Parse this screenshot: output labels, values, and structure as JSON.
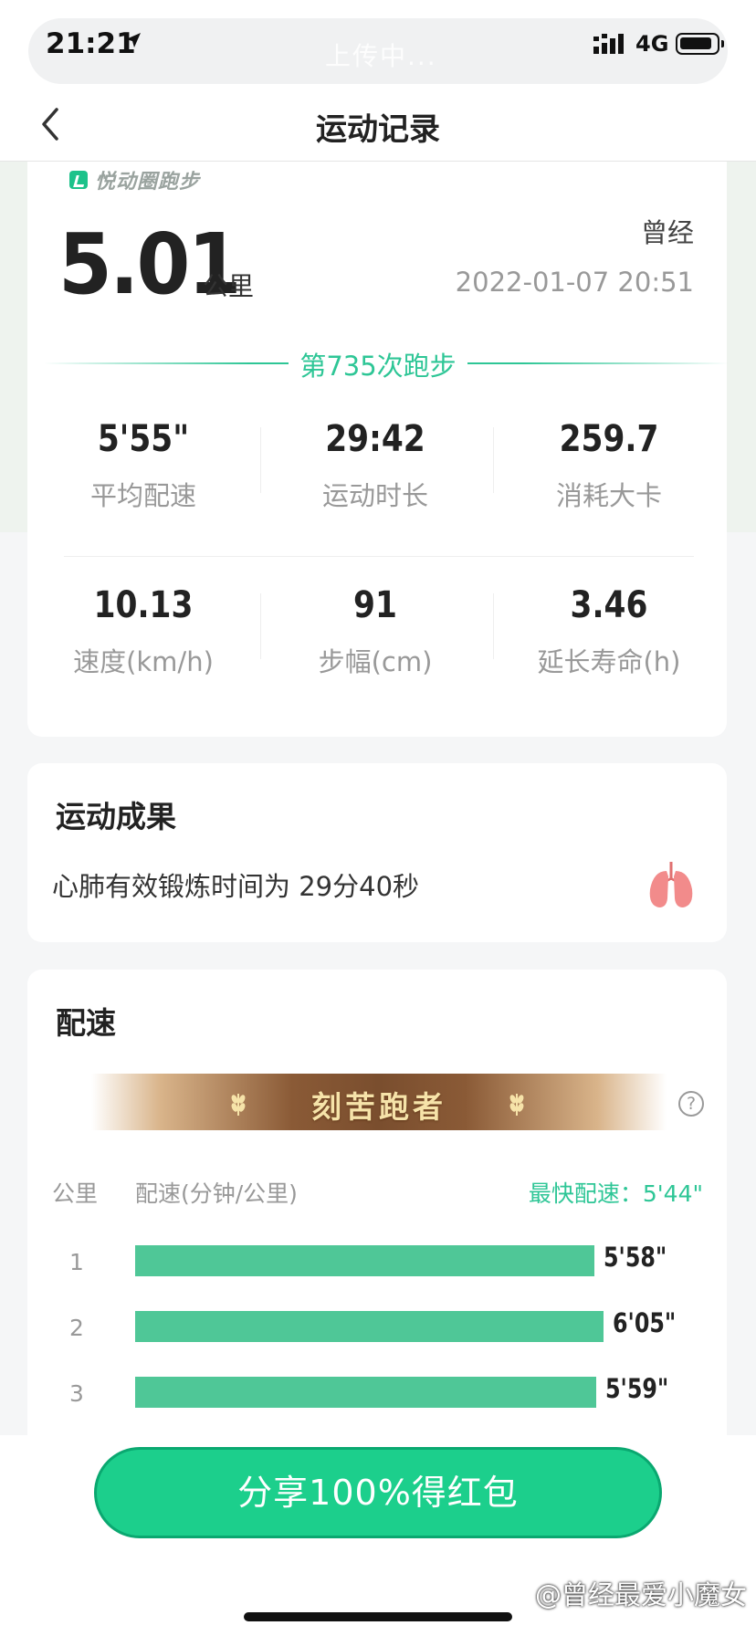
{
  "status_bar": {
    "time": "21:21",
    "upload_status": "上传中...",
    "network": "4G"
  },
  "nav": {
    "title": "运动记录"
  },
  "summary": {
    "brand": "悦动圈跑步",
    "distance": "5.01",
    "distance_unit": "公里",
    "username": "曾经",
    "datetime": "2022-01-07 20:51",
    "run_count": "第735次跑步",
    "stats": [
      {
        "value": "5'55\"",
        "label": "平均配速"
      },
      {
        "value": "29:42",
        "label": "运动时长"
      },
      {
        "value": "259.7",
        "label": "消耗大卡"
      },
      {
        "value": "10.13",
        "label": "速度(km/h)"
      },
      {
        "value": "91",
        "label": "步幅(cm)"
      },
      {
        "value": "3.46",
        "label": "延长寿命(h)"
      }
    ]
  },
  "achievement": {
    "title": "运动成果",
    "text": "心肺有效锻炼时间为  29分40秒",
    "icon": "lung-icon"
  },
  "pace": {
    "title": "配速",
    "badge": "刻苦跑者",
    "col_km": "公里",
    "col_pace": "配速(分钟/公里)",
    "fastest": "最快配速：5'44\"",
    "rows": [
      {
        "km": "1",
        "pace": "5'58\"",
        "seconds": 358
      },
      {
        "km": "2",
        "pace": "6'05\"",
        "seconds": 365
      },
      {
        "km": "3",
        "pace": "5'59\"",
        "seconds": 359
      }
    ],
    "bar_color": "#4fc797"
  },
  "share_button": "分享100%得红包",
  "watermark": "@曾经最爱小魔女",
  "colors": {
    "accent": "#2ec696",
    "button": "#1ccf8c"
  }
}
